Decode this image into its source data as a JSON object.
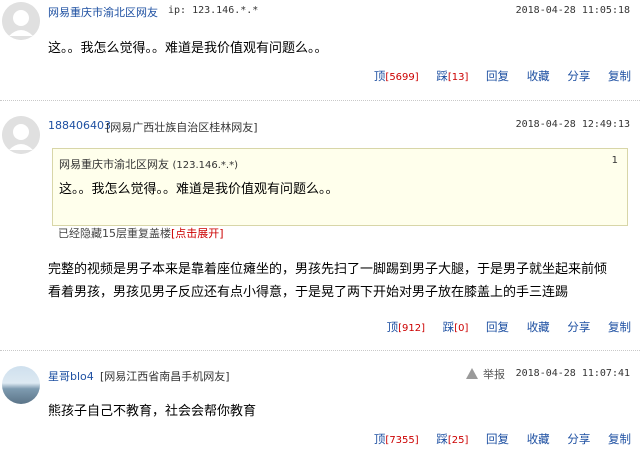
{
  "comments": [
    {
      "user": "网易重庆市渝北区网友",
      "ip": "ip: 123.146.*.*",
      "time": "2018-04-28 11:05:18",
      "text": "这。。我怎么觉得。。难道是我价值观有问题么。。",
      "actions": {
        "up": "顶",
        "up_count": "[5699]",
        "down": "踩",
        "down_count": "[13]",
        "reply": "回复",
        "fav": "收藏",
        "share": "分享",
        "copy": "复制"
      }
    },
    {
      "user": "188406403",
      "location": "[网易广西壮族自治区桂林网友]",
      "time": "2018-04-28 12:49:13",
      "quote": {
        "user": "网易重庆市渝北区网友",
        "ip": "(123.146.*.*)",
        "index": "1",
        "text": "这。。我怎么觉得。。难道是我价值观有问题么。。"
      },
      "hidden_notice": "已经隐藏15层重复盖楼",
      "expand_label": "[点击展开]",
      "text_lines": [
        "完整的视频是男子本来是靠着座位瘫坐的，男孩先扫了一脚踢到男子大腿，于是男子就坐起来前倾",
        "看着男孩，男孩见男子反应还有点小得意，于是晃了两下开始对男子放在膝盖上的手三连踢"
      ],
      "actions": {
        "up": "顶",
        "up_count": "[912]",
        "down": "踩",
        "down_count": "[0]",
        "reply": "回复",
        "fav": "收藏",
        "share": "分享",
        "copy": "复制"
      }
    },
    {
      "user": "星哥blo4",
      "location": "[网易江西省南昌手机网友]",
      "report": "举报",
      "time": "2018-04-28 11:07:41",
      "text": "熊孩子自己不教育，社会会帮你教育",
      "actions": {
        "up": "顶",
        "up_count": "[7355]",
        "down": "踩",
        "down_count": "[25]",
        "reply": "回复",
        "fav": "收藏",
        "share": "分享",
        "copy": "复制"
      }
    }
  ],
  "colors": {
    "link": "#1e50a2",
    "count": "#cc0000",
    "quote_bg": "#ffffec"
  }
}
